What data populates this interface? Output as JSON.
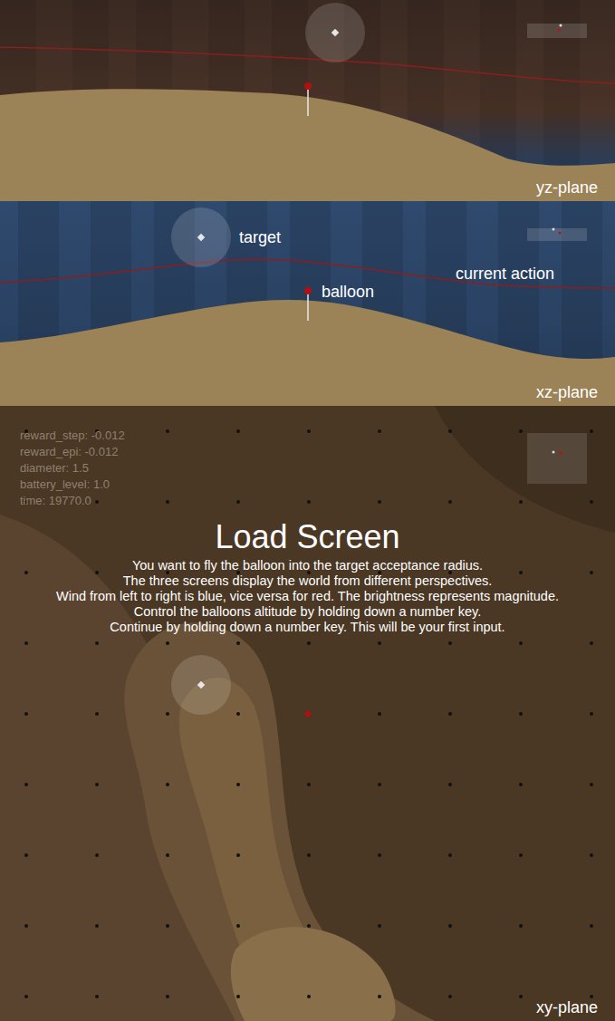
{
  "panels": {
    "yz": {
      "label": "yz-plane"
    },
    "xz": {
      "label": "xz-plane",
      "annotations": {
        "target": "target",
        "balloon": "balloon",
        "current_action": "current action"
      }
    },
    "xy": {
      "label": "xy-plane"
    }
  },
  "stats": [
    "reward_step: -0.012",
    "reward_epi: -0.012",
    "diameter: 1.5",
    "battery_level: 1.0",
    "time: 19770.0"
  ],
  "load_screen": {
    "title": "Load Screen",
    "lines": [
      "You want to fly the balloon into the target acceptance radius.",
      "The three screens display the world from different perspectives.",
      "Wind from left to right is blue, vice versa for red. The brightness represents magnitude.",
      "Control the balloons altitude by holding down a number key.",
      "Continue by holding down a number key. This will be your first input."
    ]
  }
}
